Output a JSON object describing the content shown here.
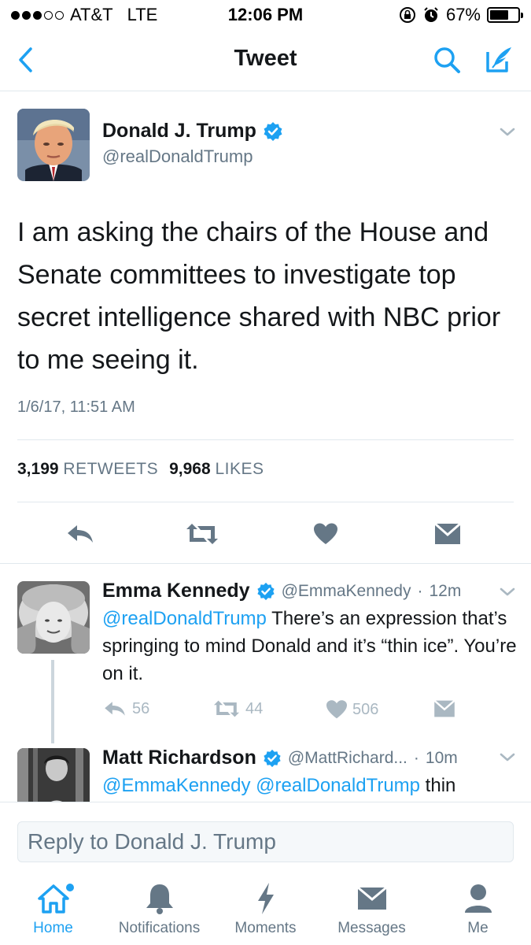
{
  "status_bar": {
    "carrier": "AT&T",
    "network": "LTE",
    "time": "12:06 PM",
    "battery_percent": "67%",
    "battery_level": 0.67,
    "signal_bars_filled": 3,
    "signal_bars_total": 5
  },
  "nav": {
    "title": "Tweet",
    "back_icon": "chevron-left-icon",
    "search_icon": "search-icon",
    "compose_icon": "compose-icon"
  },
  "main_tweet": {
    "author_name": "Donald J. Trump",
    "author_handle": "@realDonaldTrump",
    "verified": true,
    "text": "I am asking the chairs of the House and Senate committees to investigate top secret intelligence shared with NBC prior to me seeing it.",
    "date": "1/6/17, 11:51 AM",
    "retweets_count": "3,199",
    "retweets_label": "RETWEETS",
    "likes_count": "9,968",
    "likes_label": "LIKES"
  },
  "replies": [
    {
      "author_name": "Emma Kennedy",
      "author_handle": "@EmmaKennedy",
      "time": "12m",
      "mention": "@realDonaldTrump",
      "text": " There’s an expression that’s springing to mind Donald and it’s “thin ice”. You’re on it.",
      "reply_count": "56",
      "retweet_count": "44",
      "like_count": "506"
    },
    {
      "author_name": "Matt Richardson",
      "author_handle": "@MattRichard...",
      "time": "10m",
      "mention": "@EmmaKennedy @realDonaldTrump",
      "text": " thin"
    }
  ],
  "reply_box": {
    "placeholder": "Reply to Donald J. Trump"
  },
  "tabs": [
    {
      "label": "Home",
      "icon": "home-icon",
      "active": true
    },
    {
      "label": "Notifications",
      "icon": "bell-icon",
      "active": false
    },
    {
      "label": "Moments",
      "icon": "lightning-icon",
      "active": false
    },
    {
      "label": "Messages",
      "icon": "envelope-icon",
      "active": false
    },
    {
      "label": "Me",
      "icon": "person-icon",
      "active": false
    }
  ],
  "colors": {
    "accent": "#1da1f2",
    "text": "#14171a",
    "secondary": "#657786",
    "muted_icon": "#aab8c2",
    "action_icon": "#657786"
  }
}
